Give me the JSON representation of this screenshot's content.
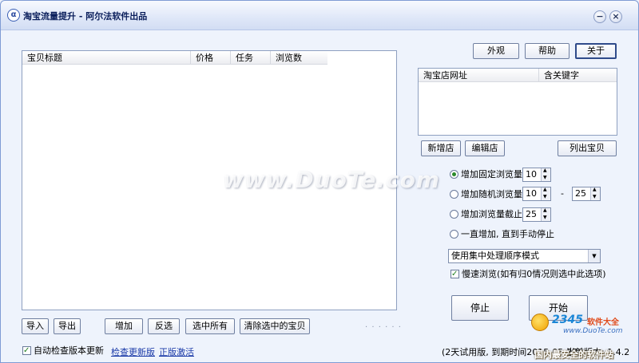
{
  "window": {
    "title": "淘宝流量提升 - 阿尔法软件出品",
    "minimize_glyph": "−",
    "close_glyph": "×"
  },
  "top_buttons": {
    "appearance": "外观",
    "help": "帮助",
    "about": "关于"
  },
  "item_table": {
    "columns": [
      "宝贝标题",
      "价格",
      "任务",
      "浏览数"
    ],
    "rows": []
  },
  "shop_table": {
    "columns": [
      "淘宝店网址",
      "含关键字"
    ],
    "rows": []
  },
  "shop_buttons": {
    "add_shop": "新增店",
    "edit_shop": "编辑店",
    "list_items": "列出宝贝"
  },
  "options": {
    "fixed": {
      "label": "增加固定浏览量",
      "value": "10",
      "selected": true
    },
    "random": {
      "label": "增加随机浏览量",
      "min": "10",
      "dash": "-",
      "max": "25",
      "selected": false
    },
    "until": {
      "label": "增加浏览量截止",
      "value": "25",
      "selected": false
    },
    "forever": {
      "label": "一直增加, 直到手动停止",
      "selected": false
    }
  },
  "mode_select": {
    "value": "使用集中处理顺序模式"
  },
  "slow_browse": {
    "label": "慢速浏览(如有归0情况则选中此选项)",
    "checked": true
  },
  "action_buttons": {
    "stop": "停止",
    "start": "开始"
  },
  "bottom_buttons": {
    "import": "导入",
    "export": "导出",
    "add": "增加",
    "invert": "反选",
    "select_all": "选中所有",
    "clear_selected": "清除选中的宝贝"
  },
  "footer": {
    "auto_update_label": "自动检查版本更新",
    "auto_update_checked": true,
    "check_update_link": "检查更新版",
    "activate_link": "正版激活",
    "trial_status": "(2天试用版, 到期时间2015-05-27)",
    "version_status": "当前版本: 1.4.2"
  },
  "watermark": {
    "text": "www.DuoTe.com"
  },
  "logo": {
    "brand": "2345",
    "site": "软件大全",
    "url": "www.DuoTe.com",
    "slogan": "国内最安全的软件站"
  },
  "colors": {
    "title_text": "#0b1f5c",
    "link": "#1a3aa8",
    "window_bg": "#eef3fc"
  }
}
